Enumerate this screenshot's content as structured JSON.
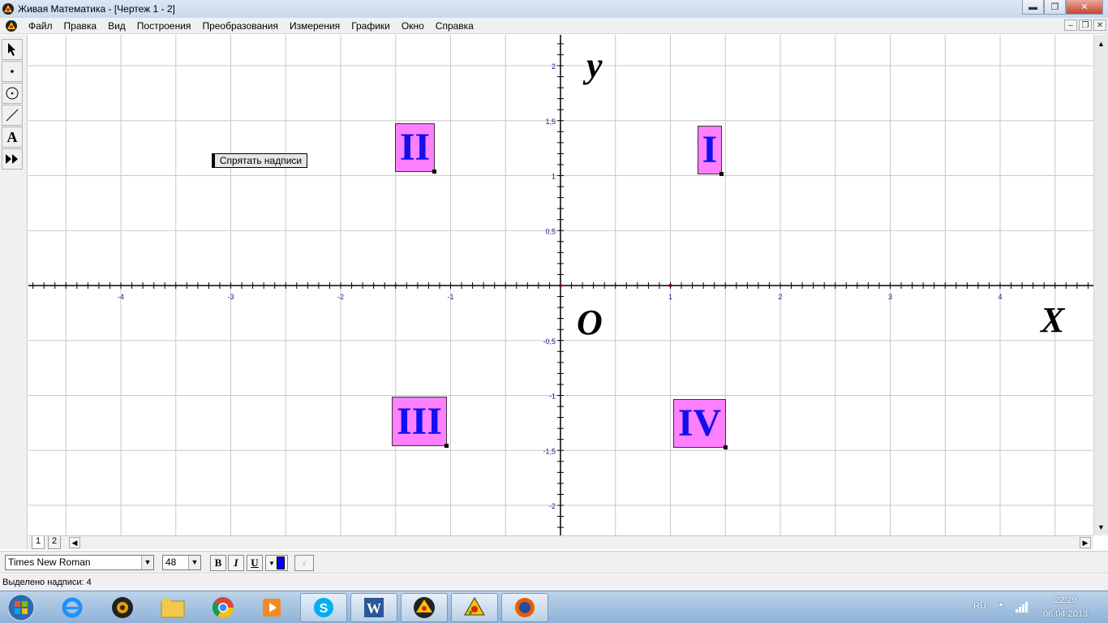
{
  "window": {
    "title": "Живая Математика - [Чертеж 1 - 2]",
    "min_label": "▬",
    "max_label": "❐",
    "close_label": "✕"
  },
  "menu": {
    "items": [
      "Файл",
      "Правка",
      "Вид",
      "Построения",
      "Преобразования",
      "Измерения",
      "Графики",
      "Окно",
      "Справка"
    ],
    "mdi_min": "–",
    "mdi_restore": "❐",
    "mdi_close": "✕"
  },
  "tools": [
    "arrow-tool",
    "point-tool",
    "compass-tool",
    "straightedge-tool",
    "text-tool",
    "custom-tool"
  ],
  "tool_labels": {
    "text": "A"
  },
  "canvas": {
    "hide_button_label": "Спрятать надписи",
    "quadrants": [
      "I",
      "II",
      "III",
      "IV"
    ],
    "x_letter": "X",
    "y_letter": "y",
    "origin_letter": "O",
    "x_ticks": [
      "-4",
      "-3",
      "-2",
      "-1",
      "1",
      "2",
      "3",
      "4"
    ],
    "y_ticks": [
      "2",
      "1,5",
      "1",
      "0,5",
      "-0,5",
      "-1",
      "-1,5",
      "-2"
    ]
  },
  "pages": {
    "tab1": "1",
    "tab2": "2"
  },
  "format": {
    "font": "Times New Roman",
    "size": "48",
    "bold": "B",
    "italic": "I",
    "underline": "U",
    "color": "#0000ff"
  },
  "status": {
    "text": "Выделено надписи: 4"
  },
  "taskbar": {
    "apps": [
      "start-orb",
      "internet-explorer-icon",
      "media-player-icon",
      "folder-icon",
      "chrome-icon",
      "media-center-icon",
      "skype-icon",
      "word-icon",
      "gsp-icon",
      "gsp-alt-icon",
      "firefox-icon"
    ],
    "lang": "RU",
    "time": "22:29",
    "date": "06.04.2013"
  },
  "colors": {
    "label_bg": "#ff80ff",
    "label_text": "#1010ee",
    "grid": "#c8c8c8"
  }
}
